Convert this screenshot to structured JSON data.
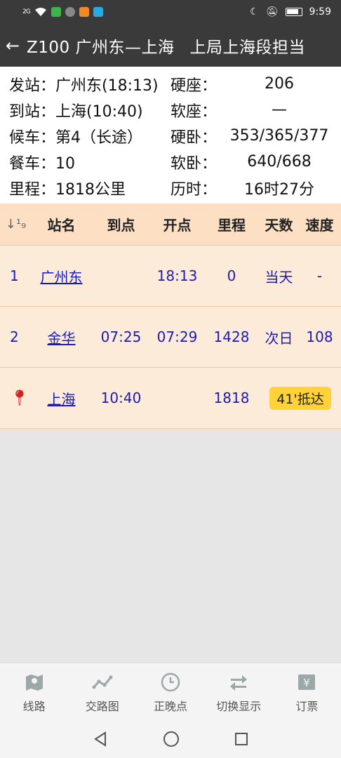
{
  "status_bar": {
    "signal": "2G",
    "time": "9:59"
  },
  "header": {
    "back_icon": "arrow-left-icon",
    "train": "Z100",
    "route": "广州东—上海",
    "bureau": "上局上海段担当"
  },
  "info": {
    "rows": [
      {
        "k1": "发站：",
        "v1": "广州东(18:13)",
        "k2": "硬座：",
        "v2": "206"
      },
      {
        "k1": "到站：",
        "v1": "上海(10:40)",
        "k2": "软座：",
        "v2": "—"
      },
      {
        "k1": "候车：",
        "v1": "第4（长途）",
        "k2": "硬卧：",
        "v2": "353/365/377"
      },
      {
        "k1": "餐车：",
        "v1": "10",
        "k2": "软卧：",
        "v2": "640/668"
      },
      {
        "k1": "里程：",
        "v1": "1818公里",
        "k2": "历时：",
        "v2": "16时27分"
      }
    ]
  },
  "table": {
    "headers": {
      "station": "站名",
      "arrive": "到点",
      "depart": "开点",
      "km": "里程",
      "day": "天数",
      "speed": "速度"
    },
    "rows": [
      {
        "idx": "1",
        "station": "广州东",
        "arrive": "",
        "depart": "18:13",
        "km": "0",
        "day": "当天",
        "speed": "-"
      },
      {
        "idx": "2",
        "station": "金华",
        "arrive": "07:25",
        "depart": "07:29",
        "km": "1428",
        "day": "次日",
        "speed": "108"
      },
      {
        "idx": "",
        "station": "上海",
        "arrive": "10:40",
        "depart": "",
        "km": "1818",
        "badge": "41'抵达"
      }
    ]
  },
  "bottom_nav": [
    {
      "label": "线路",
      "icon": "map-icon"
    },
    {
      "label": "交路图",
      "icon": "route-graph-icon"
    },
    {
      "label": "正晚点",
      "icon": "clock-icon"
    },
    {
      "label": "切换显示",
      "icon": "swap-icon"
    },
    {
      "label": "订票",
      "icon": "ticket-icon"
    }
  ],
  "colors": {
    "header_bg": "#3a3a3a",
    "table_header_bg": "#fde0c4",
    "row_bg": "#fdebd9",
    "link": "#1a1ab5",
    "badge": "#ffd23a"
  }
}
